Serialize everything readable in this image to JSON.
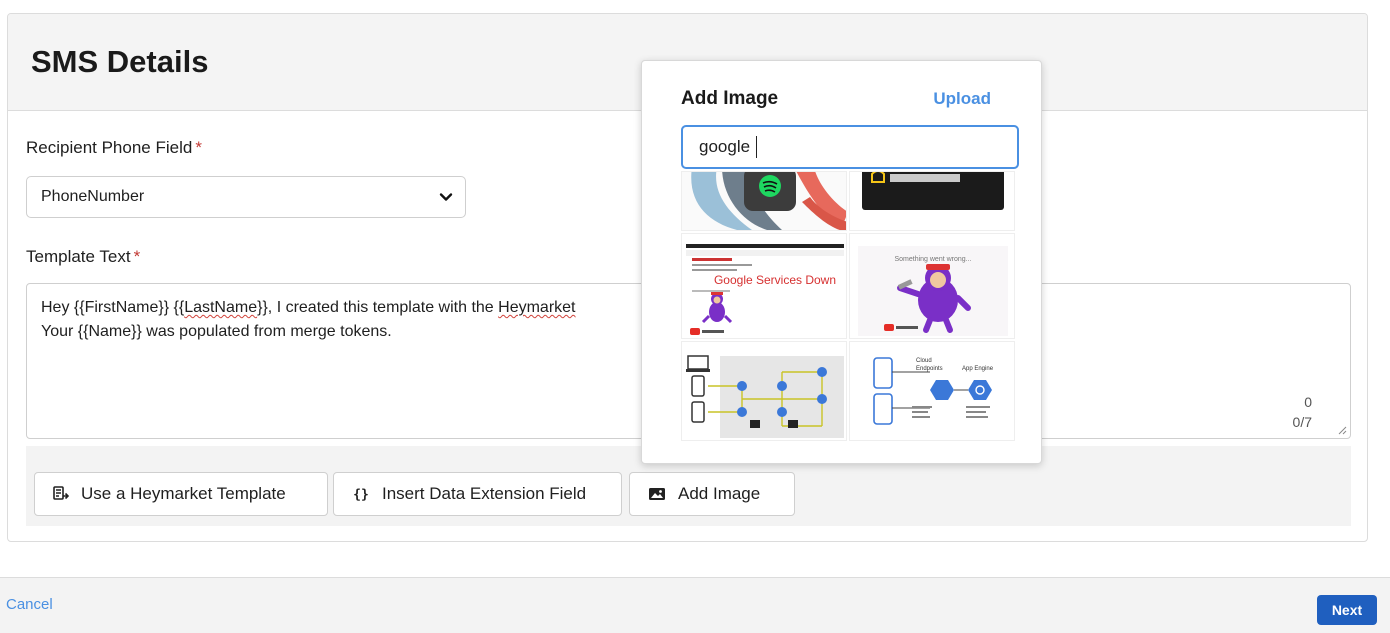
{
  "card": {
    "title": "SMS Details"
  },
  "recipient": {
    "label": "Recipient Phone Field",
    "required_mark": "*",
    "selected": "PhoneNumber"
  },
  "template": {
    "label": "Template Text",
    "required_mark": "*",
    "line1_prefix": "Hey {{FirstName}}  {{",
    "line1_token": "LastName",
    "line1_mid": "}}, I created this template with the ",
    "line1_brand": "Heymarket",
    "line2": "Your {{Name}} was populated from merge tokens.",
    "counter_chars": "0",
    "counter_segments": "0/7"
  },
  "toolbar": {
    "use_template": "Use a Heymarket Template",
    "insert_field": "Insert Data Extension Field",
    "add_image": "Add Image"
  },
  "popover": {
    "title": "Add Image",
    "upload": "Upload",
    "search_value": "google",
    "thumb_google_caption": "Google Services Down",
    "thumb_error_caption": "Something went wrong...",
    "thumb_cloud_title": "Cloud\nEndpoints",
    "thumb_appengine": "App Engine"
  },
  "footer": {
    "cancel": "Cancel",
    "next": "Next"
  },
  "colors": {
    "accent": "#4a90e2",
    "primary_button": "#1f5fbf",
    "required": "#c23934"
  }
}
